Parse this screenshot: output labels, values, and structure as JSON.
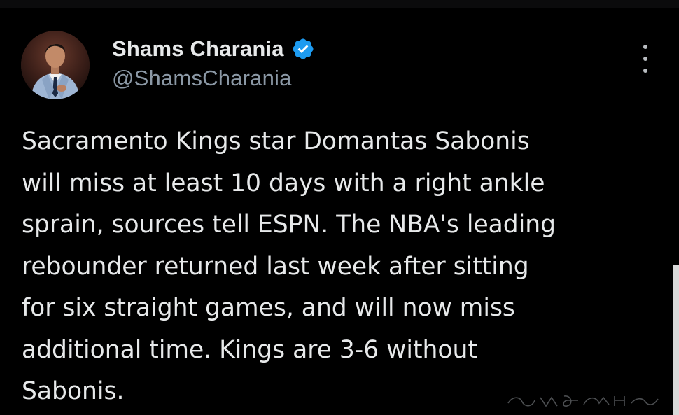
{
  "author": {
    "display_name": "Shams Charania",
    "handle": "@ShamsCharania",
    "verified": true,
    "avatar_icon": "profile-photo"
  },
  "tweet": {
    "lines": [
      "Sacramento Kings star Domantas Sabonis",
      "will miss at least 10 days with a right ankle",
      "sprain, sources tell ESPN. The NBA's leading",
      "rebounder returned last week after sitting",
      "for six straight games, and will now miss",
      "additional time. Kings are 3-6 without",
      "Sabonis."
    ]
  },
  "colors": {
    "background": "#000000",
    "text_primary": "#e7e9ea",
    "text_secondary": "#8b98a5",
    "verified_badge": "#1d9bf0"
  },
  "icons": {
    "verified": "verified-badge-icon",
    "more": "more-options-icon"
  }
}
